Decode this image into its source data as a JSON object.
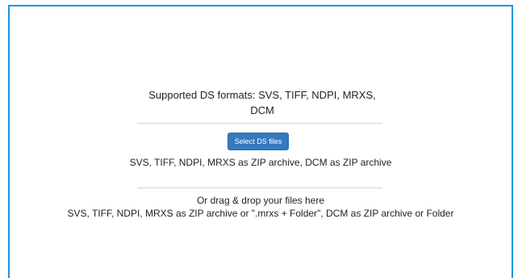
{
  "colors": {
    "frame_border": "#1b95e0",
    "button_background": "#3579bf",
    "button_text": "#ffffff",
    "divider": "#cfd4d9",
    "text": "#222222"
  },
  "upload": {
    "formats_title": "Supported DS formats: SVS, TIFF, NDPI, MRXS, DCM",
    "select_button_label": "Select DS files",
    "select_hint": "SVS, TIFF, NDPI, MRXS as ZIP archive, DCM as ZIP archive",
    "drag_title": "Or drag & drop your files here",
    "drag_hint": "SVS, TIFF, NDPI, MRXS as ZIP archive or \".mrxs + Folder\", DCM as ZIP archive or Folder"
  }
}
